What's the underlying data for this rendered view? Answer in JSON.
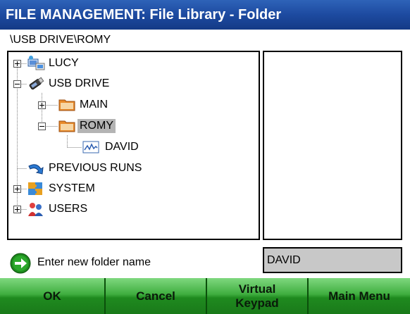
{
  "window": {
    "title": "FILE MANAGEMENT: File Library - Folder"
  },
  "path": "\\USB DRIVE\\ROMY",
  "tree": {
    "nodes": [
      {
        "label": "LUCY",
        "icon": "network-computer-icon",
        "expander": "plus",
        "selected": false
      },
      {
        "label": "USB DRIVE",
        "icon": "usb-drive-icon",
        "expander": "minus",
        "selected": false
      },
      {
        "label": "MAIN",
        "icon": "folder-icon",
        "expander": "plus",
        "selected": false
      },
      {
        "label": "ROMY",
        "icon": "folder-icon",
        "expander": "minus",
        "selected": true
      },
      {
        "label": "DAVID",
        "icon": "waveform-file-icon",
        "expander": "none",
        "selected": false
      },
      {
        "label": "PREVIOUS RUNS",
        "icon": "previous-runs-arrow-icon",
        "expander": "none",
        "selected": false
      },
      {
        "label": "SYSTEM",
        "icon": "system-puzzle-icon",
        "expander": "plus",
        "selected": false
      },
      {
        "label": "USERS",
        "icon": "users-icon",
        "expander": "plus",
        "selected": false
      }
    ]
  },
  "prompt": {
    "icon": "green-arrow-icon",
    "label": "Enter new folder name"
  },
  "folder_name_input": {
    "value": "DAVID"
  },
  "buttons": {
    "ok": "OK",
    "cancel": "Cancel",
    "virtual_keypad_line1": "Virtual",
    "virtual_keypad_line2": "Keypad",
    "main_menu": "Main Menu"
  },
  "colors": {
    "title_bar": "#1d4aa0",
    "button_green": "#3fae3f",
    "selection_gray": "#b4b4b4",
    "input_gray": "#c8c8c8"
  }
}
